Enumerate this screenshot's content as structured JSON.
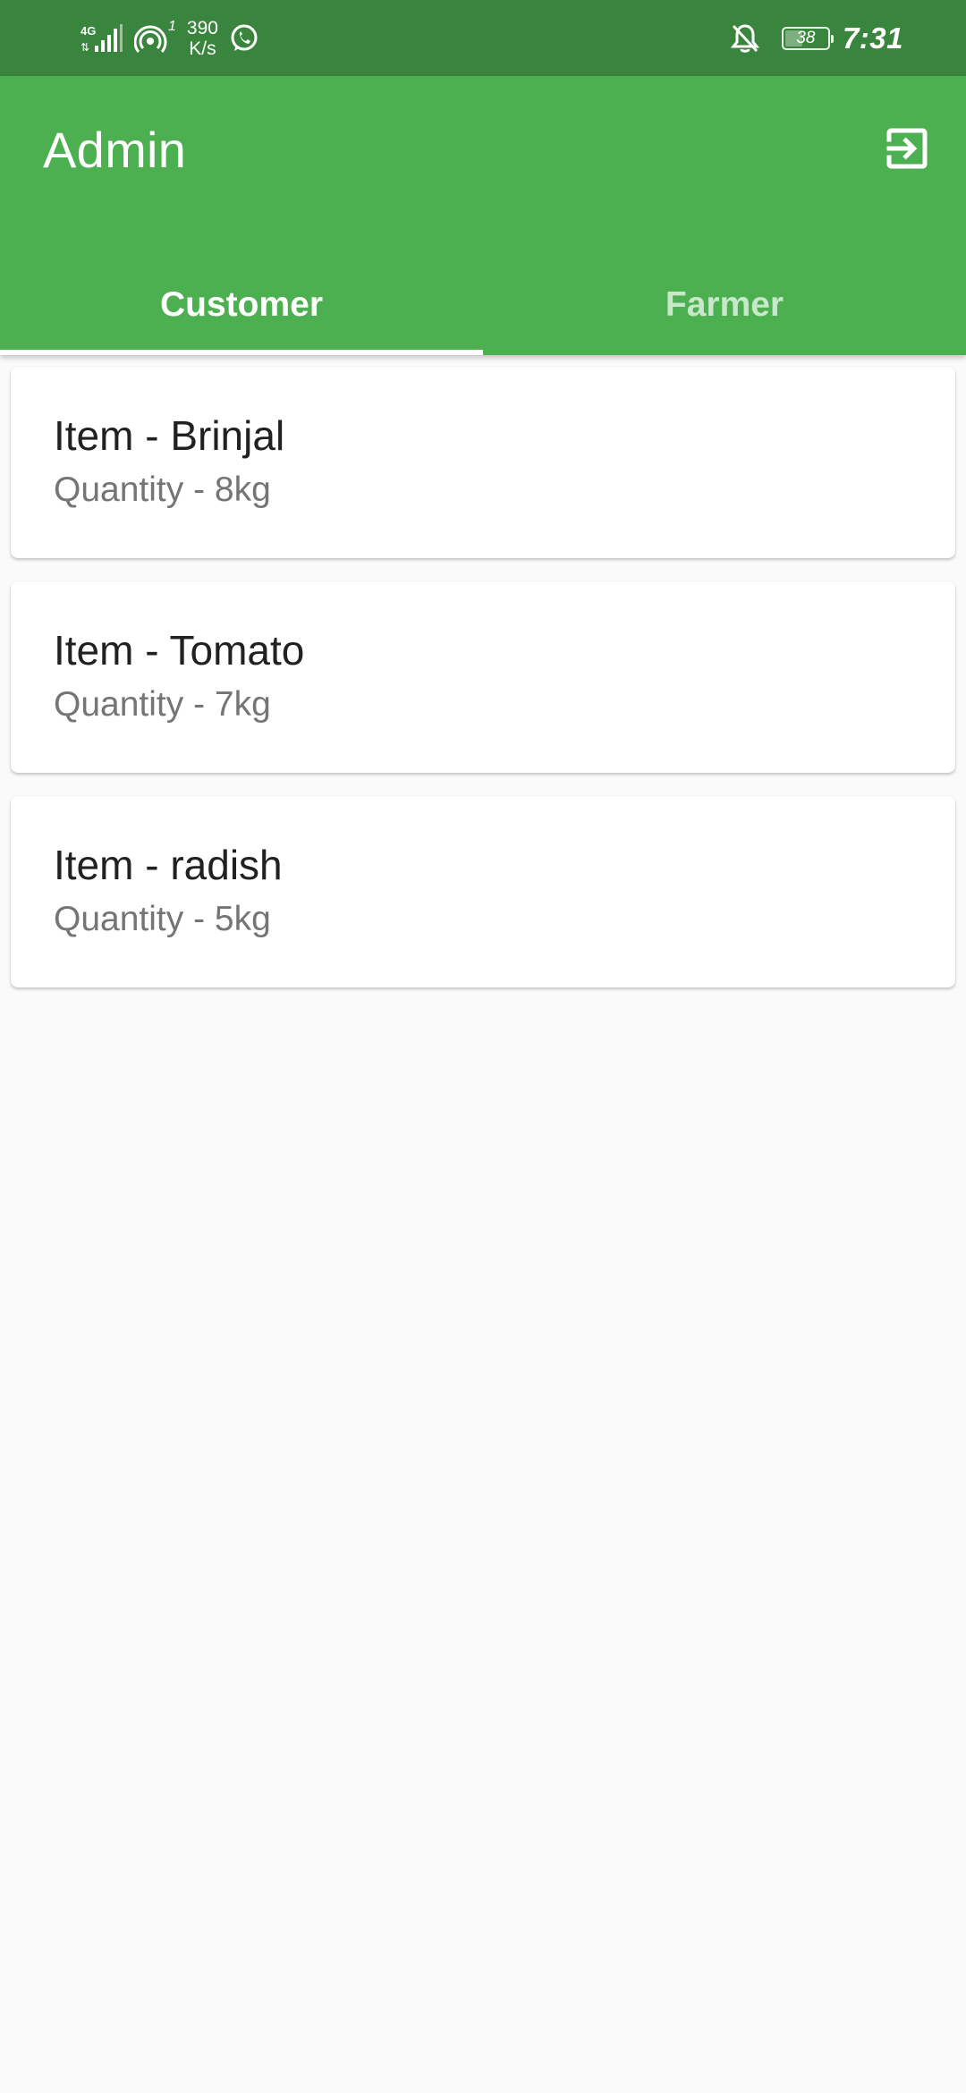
{
  "status_bar": {
    "network_type": "4G",
    "hotspot_count": "1",
    "speed_value": "390",
    "speed_unit": "K/s",
    "battery_level": "38",
    "battery_fraction": 0.38,
    "time": "7:31",
    "icons": [
      "signal-icon",
      "hotspot-icon",
      "whatsapp-icon",
      "bell-off-icon",
      "battery-icon"
    ]
  },
  "app_bar": {
    "title": "Admin",
    "action_icon": "logout-icon",
    "color": "#4caf50"
  },
  "tabs": [
    {
      "label": "Customer",
      "active": true
    },
    {
      "label": "Farmer",
      "active": false
    }
  ],
  "items": [
    {
      "title": "Item - Brinjal",
      "quantity": "Quantity - 8kg"
    },
    {
      "title": "Item - Tomato",
      "quantity": "Quantity - 7kg"
    },
    {
      "title": "Item - radish",
      "quantity": "Quantity - 5kg"
    }
  ],
  "colors": {
    "status_bar": "#3a853e",
    "primary": "#4caf50",
    "background": "#fafafa"
  }
}
